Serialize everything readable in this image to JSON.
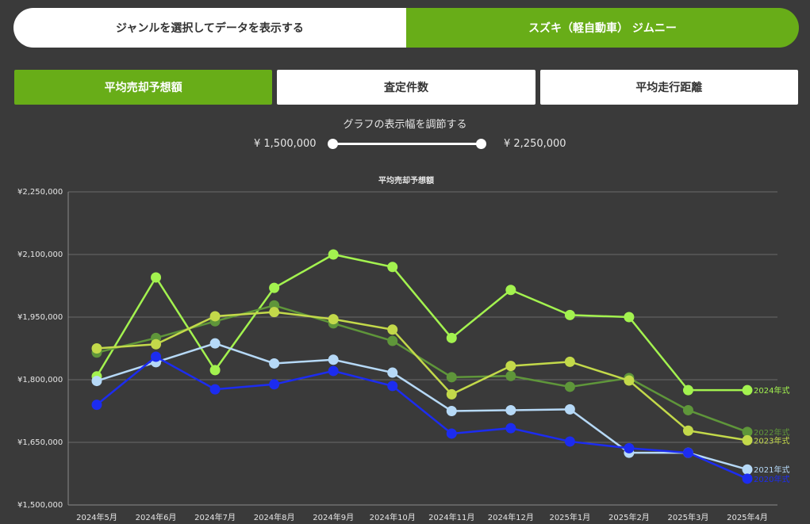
{
  "top_toggle": {
    "left_label": "ジャンルを選択してデータを表示する",
    "right_label": "スズキ（軽自動車） ジムニー"
  },
  "tabs": [
    {
      "label": "平均売却予想額",
      "active": true
    },
    {
      "label": "査定件数",
      "active": false
    },
    {
      "label": "平均走行距離",
      "active": false
    }
  ],
  "range": {
    "title": "グラフの表示幅を調節する",
    "min_label": "¥ 1,500,000",
    "max_label": "¥ 2,250,000",
    "min_value": 1500000,
    "max_value": 2250000
  },
  "colors": {
    "accent": "#68ad18",
    "background": "#3a3a3a"
  },
  "chart_data": {
    "type": "line",
    "title": "平均売却予想額",
    "categories": [
      "2024年5月",
      "2024年6月",
      "2024年7月",
      "2024年8月",
      "2024年9月",
      "2024年10月",
      "2024年11月",
      "2024年12月",
      "2025年1月",
      "2025年2月",
      "2025年3月",
      "2025年4月"
    ],
    "y_ticks": [
      "¥1,500,000",
      "¥1,650,000",
      "¥1,800,000",
      "¥1,950,000",
      "¥2,100,000",
      "¥2,250,000"
    ],
    "ylim": [
      1500000,
      2250000
    ],
    "grid": true,
    "series": [
      {
        "name": "2024年式",
        "color": "#a3f24f",
        "values": [
          1808000,
          2045000,
          1823000,
          2020000,
          2100000,
          2070000,
          1900000,
          2015000,
          1955000,
          1950000,
          1775000,
          1775000
        ]
      },
      {
        "name": "2022年式",
        "color": "#5f963a",
        "values": [
          1865000,
          1900000,
          1940000,
          1978000,
          1935000,
          1893000,
          1806000,
          1809000,
          1783000,
          1804000,
          1727000,
          1675000
        ]
      },
      {
        "name": "2023年式",
        "color": "#c3d94a",
        "values": [
          1875000,
          1885000,
          1952000,
          1962000,
          1945000,
          1920000,
          1765000,
          1833000,
          1843000,
          1798000,
          1678000,
          1655000
        ]
      },
      {
        "name": "2021年式",
        "color": "#b6d9f7",
        "values": [
          1797000,
          1842000,
          1887000,
          1839000,
          1848000,
          1817000,
          1725000,
          1727000,
          1729000,
          1625000,
          1625000,
          1585000
        ]
      },
      {
        "name": "2020年式",
        "color": "#1c2cf0",
        "values": [
          1740000,
          1855000,
          1777000,
          1789000,
          1821000,
          1785000,
          1671000,
          1684000,
          1652000,
          1636000,
          1625000,
          1563000
        ]
      }
    ]
  }
}
